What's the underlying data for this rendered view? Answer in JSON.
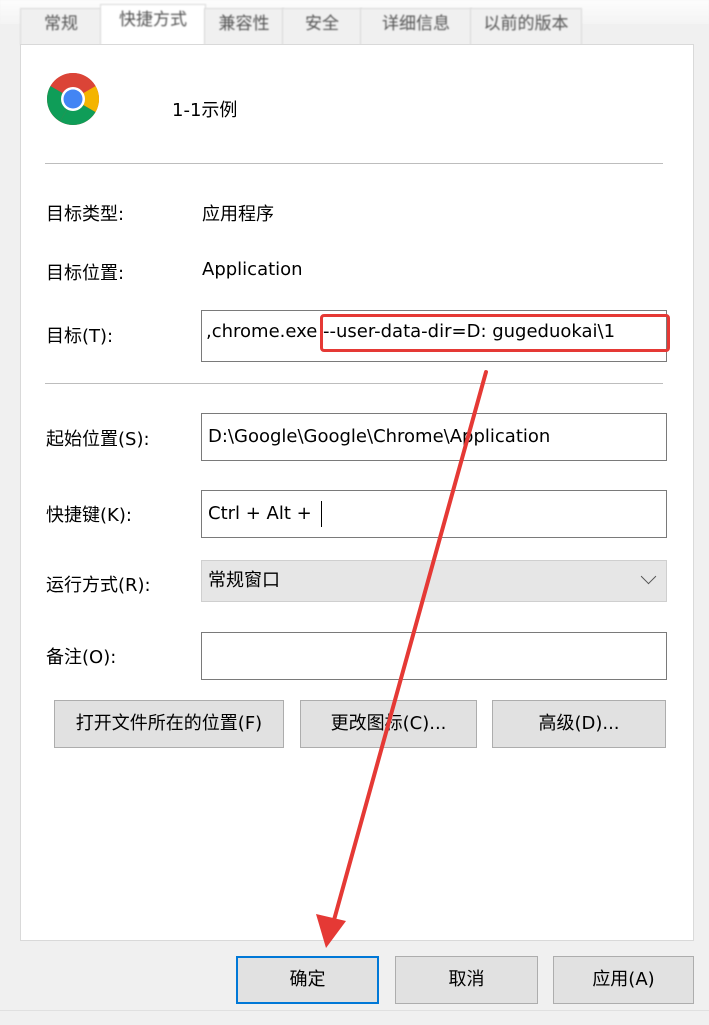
{
  "tabs": [
    {
      "label": "常规"
    },
    {
      "label": "快捷方式",
      "active": true
    },
    {
      "label": "兼容性"
    },
    {
      "label": "安全"
    },
    {
      "label": "详细信息"
    },
    {
      "label": "以前的版本"
    }
  ],
  "app": {
    "name": "1-1示例",
    "icon": "chrome-icon"
  },
  "target_type": {
    "label": "目标类型:",
    "value": "应用程序"
  },
  "target_location": {
    "label": "目标位置:",
    "value": "Application"
  },
  "target": {
    "label": "目标(T):",
    "value_prefix": ",chrome.exe",
    "value_highlight": " --user-data-dir=D: gugeduokai\\1"
  },
  "start_in": {
    "label": "起始位置(S):",
    "value": "D:\\Google\\Google\\Chrome\\Application"
  },
  "shortcut_key": {
    "label": "快捷键(K):",
    "value": "Ctrl + Alt + "
  },
  "run": {
    "label": "运行方式(R):",
    "value": "常规窗口"
  },
  "comment": {
    "label": "备注(O):",
    "value": ""
  },
  "buttons": {
    "open_location": "打开文件所在的位置(F)",
    "change_icon": "更改图标(C)...",
    "advanced": "高级(D)..."
  },
  "footer": {
    "ok": "确定",
    "cancel": "取消",
    "apply": "应用(A)"
  },
  "colors": {
    "annotation": "#e53935",
    "accent": "#0078d7"
  }
}
